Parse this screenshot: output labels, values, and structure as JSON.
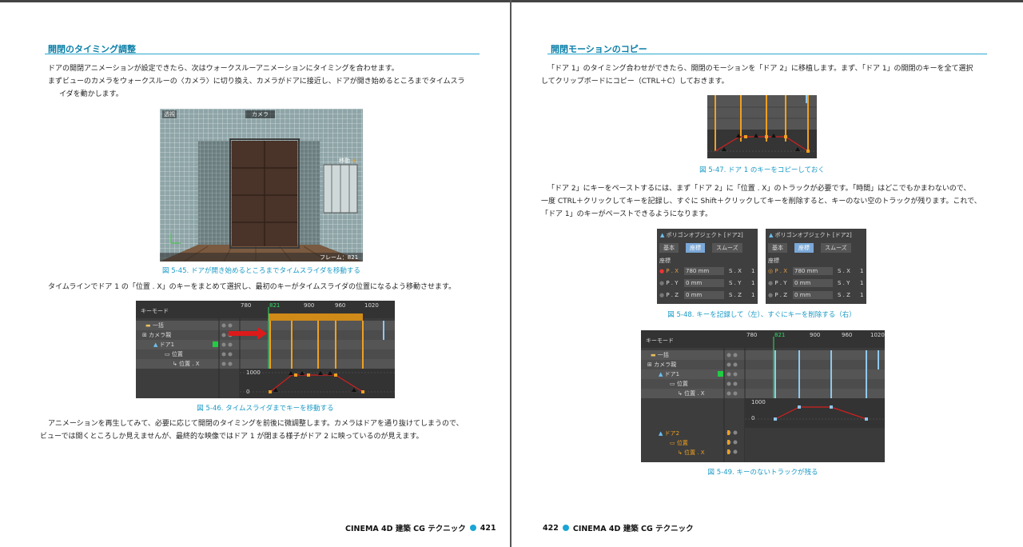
{
  "left": {
    "title": "開閉のタイミング調整",
    "para1": [
      "ドアの開閉アニメーションが設定できたら、次はウォークスルーアニメーションにタイミングを合わせます。",
      "まずビューのカメラをウォークスルーの〈カメラ〉に切り換え、カメラがドアに接近し、ドアが開き始めるところまでタイムスラ",
      "イダを動かします。"
    ],
    "fig45": {
      "tab1": "透視",
      "tab2": "カメラ",
      "label_move": "移動",
      "frame": "フレーム：821"
    },
    "caption45": "図 5-45. ドアが開き始めるところまでタイムスライダを移動する",
    "para2": "タイムラインでドア 1 の「位置 . X」のキーをまとめて選択し、最初のキーがタイムスライダの位置になるよう移動させます。",
    "fig46": {
      "mode": "キーモード",
      "ticks": [
        "780",
        "821",
        "900",
        "960",
        "1020"
      ],
      "tracks": [
        "一括",
        "カメラ親",
        "ドア1",
        "位置",
        "位置 . X"
      ],
      "value_label": "1000",
      "zero_label": "0"
    },
    "caption46": "図 5-46. タイムスライダまでキーを移動する",
    "para3": [
      "アニメーションを再生してみて、必要に応じて開閉のタイミングを前後に微調整します。カメラはドアを通り抜けてしまうので、",
      "ビューでは開くところしか見えませんが、最終的な映像ではドア 1 が閉まる様子がドア 2 に映っているのが見えます。"
    ],
    "footer_book": "CINEMA 4D 建築 CG テクニック",
    "page_number": "421"
  },
  "right": {
    "title": "開閉モーションのコピー",
    "para1": [
      "「ドア 1」のタイミング合わせができたら、開閉のモーションを「ドア 2」に移植します。まず、「ドア 1」の開閉のキーを全て選択",
      "してクリップボードにコピー（CTRL＋C）しておきます。"
    ],
    "caption47": "図 5-47. ドア 1 のキーをコピーしておく",
    "para2": [
      "「ドア 2」にキーをペーストするには、まず「ドア 2」に「位置 . X」のトラックが必要です。「時間」はどこでもかまわないので、",
      "一度 CTRL＋クリックしてキーを記録し、すぐに Shift＋クリックしてキーを削除すると、キーのない空のトラックが残ります。これで、",
      "「ドア 1」のキーがペーストできるようになります。"
    ],
    "fig48": {
      "header": "ポリゴンオブジェクト [ドア2]",
      "tabs": [
        "基本",
        "座標",
        "スムーズ"
      ],
      "section": "座標",
      "rows": [
        {
          "label": "P . X",
          "value": "780 mm",
          "s_label": "S . X",
          "s_value": "1"
        },
        {
          "label": "P . Y",
          "value": "0 mm",
          "s_label": "S . Y",
          "s_value": "1"
        },
        {
          "label": "P . Z",
          "value": "0 mm",
          "s_label": "S . Z",
          "s_value": "1"
        }
      ]
    },
    "caption48": "図 5-48. キーを記録して（左）、すぐにキーを削除する（右）",
    "fig49": {
      "mode": "キーモード",
      "ticks": [
        "780",
        "821",
        "900",
        "960",
        "1020"
      ],
      "tracks": [
        "一括",
        "カメラ親",
        "ドア1",
        "位置",
        "位置 . X",
        "ドア2",
        "位置",
        "位置 . X"
      ],
      "value_label": "1000",
      "zero_label": "0"
    },
    "caption49": "図 5-49. キーのないトラックが残る",
    "page_number": "422",
    "footer_book": "CINEMA 4D 建築 CG テクニック"
  },
  "colors": {
    "accent": "#1aa5d3",
    "key_orange": "#f0a020",
    "curve_red": "#d02020",
    "key_green": "#22cc44"
  }
}
